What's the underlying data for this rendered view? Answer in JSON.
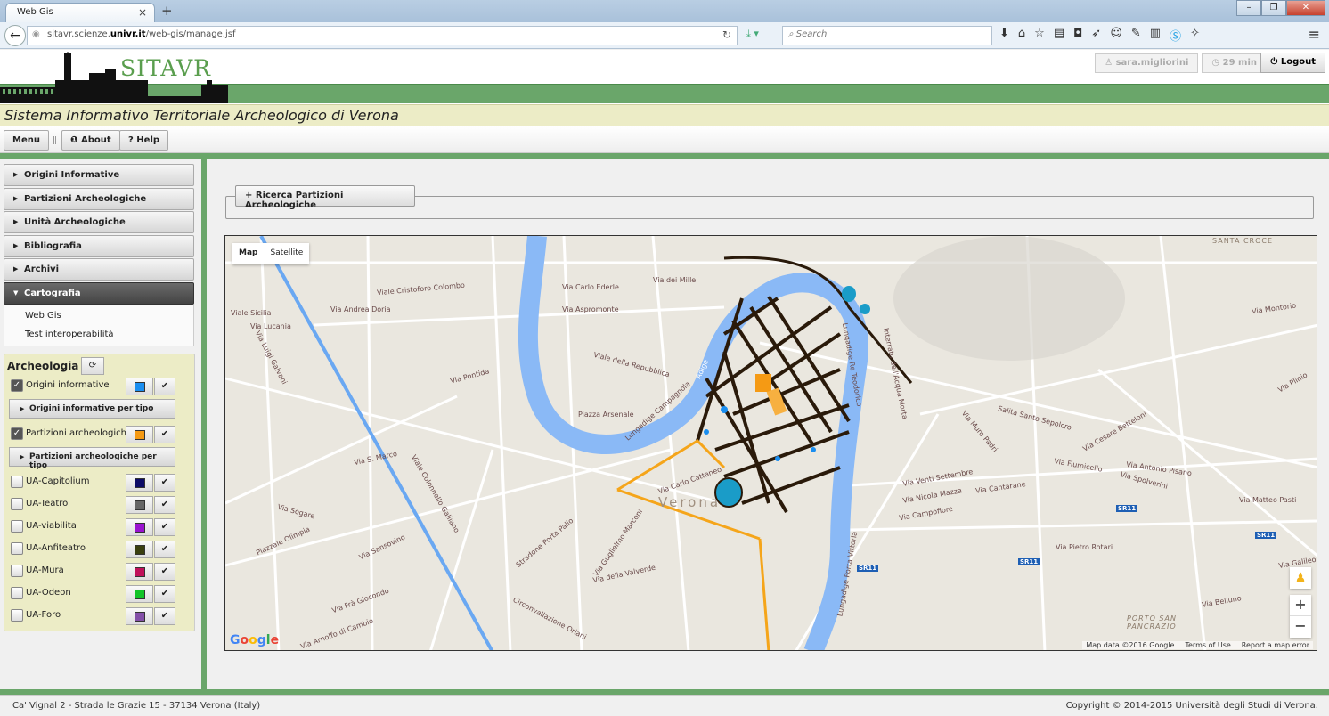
{
  "browser": {
    "tab_title": "Web Gis",
    "url_prefix": "sitavr.scienze.",
    "url_domain": "univr.it",
    "url_path": "/web-gis/manage.jsf",
    "search_placeholder": "Search"
  },
  "header": {
    "logo_text": "SITAVR",
    "user": "sara.migliorini",
    "session_time": "29 min",
    "logout_label": "Logout",
    "title": "Sistema Informativo Territoriale Archeologico di Verona"
  },
  "menubar": {
    "menu_label": "Menu",
    "about_label": "About",
    "help_label": "Help"
  },
  "sidebar": {
    "sections": [
      {
        "label": "Origini Informative"
      },
      {
        "label": "Partizioni Archeologiche"
      },
      {
        "label": "Unità Archeologiche"
      },
      {
        "label": "Bibliografia"
      },
      {
        "label": "Archivi"
      },
      {
        "label": "Cartografia"
      }
    ],
    "cartografia_items": [
      {
        "label": "Web Gis"
      },
      {
        "label": "Test interoperabilità"
      }
    ]
  },
  "layers": {
    "title": "Archeologia",
    "items": [
      {
        "label": "Origini informative",
        "checked": true,
        "color": "#1a8ef0"
      },
      {
        "label": "Partizioni archeologiche",
        "checked": true,
        "color": "#f59a14"
      },
      {
        "label": "UA-Capitolium",
        "checked": false,
        "color": "#0c0a66"
      },
      {
        "label": "UA-Teatro",
        "checked": false,
        "color": "#666666"
      },
      {
        "label": "UA-viabilita",
        "checked": false,
        "color": "#9a12d0"
      },
      {
        "label": "UA-Anfiteatro",
        "checked": false,
        "color": "#3a3f10"
      },
      {
        "label": "UA-Mura",
        "checked": false,
        "color": "#c0105a"
      },
      {
        "label": "UA-Odeon",
        "checked": false,
        "color": "#12c428"
      },
      {
        "label": "UA-Foro",
        "checked": false,
        "color": "#8450a8"
      }
    ],
    "sub_origini": "Origini informative per tipo",
    "sub_partizioni": "Partizioni archeologiche per tipo"
  },
  "main": {
    "search_panel_label": "Ricerca Partizioni Archeologiche"
  },
  "map": {
    "type_map": "Map",
    "type_satellite": "Satellite",
    "city_label": "Verona",
    "attribution": "Map data ©2016 Google",
    "terms": "Terms of Use",
    "report": "Report a map error",
    "labels": {
      "l1": "Viale Cristoforo Colombo",
      "l2": "Via Andrea Doria",
      "l3": "Viale Sicilia",
      "l4": "Via Lucania",
      "l5": "Via Luigi Galvani",
      "l6": "Via Pontida",
      "l7": "Via Carlo Ederle",
      "l8": "Via Aspromonte",
      "l9": "Via dei Mille",
      "l10": "Viale della Repubblica",
      "l11": "Piazza Arsenale",
      "l12": "Lungadige Campagnola",
      "l13": "Via Carlo Cattaneo",
      "l14": "Via S. Marco",
      "l15": "Viale Colonnello Galliano",
      "l16": "Via Sogare",
      "l17": "Piazzale Olimpia",
      "l18": "Via Sansovino",
      "l19": "Via Frà Giocondo",
      "l20": "Via Arnolfo di Cambio",
      "l21": "Stradone Porta Palio",
      "l22": "Via Guglielmo Marconi",
      "l23": "Via della Valverde",
      "l24": "Circonvallazione Oriani",
      "l25": "Lungadige Re Teodorico",
      "l26": "Interrato dell'Acqua Morta",
      "l27": "Via Venti Settembre",
      "l28": "Via Nicola Mazza",
      "l29": "Via Campofiore",
      "l30": "Via Cantarane",
      "l31": "Salita Santo Sepolcro",
      "l32": "Via Fiumicello",
      "l33": "Via Antonio Pisano",
      "l34": "Via Spolverini",
      "l35": "Via Matteo Pasti",
      "l36": "Via Pietro Rotari",
      "l37": "Via Galileo Galilei",
      "l38": "Via Belluno",
      "l39": "Via Montorio",
      "l40": "SANTA CROCE",
      "l41": "PORTO SAN PANCRAZIO",
      "l42": "Adige",
      "l43": "Lungadige Porta Vittoria",
      "l44": "Via Pietro Rotari",
      "l45": "SR11",
      "l46": "Via Muro Padri",
      "l47": "Via Cesare Betteloni",
      "l48": "Via Plinio"
    }
  },
  "footer": {
    "address": "Ca' Vignal 2 - Strada le Grazie 15 - 37134 Verona (Italy)",
    "copyright": "Copyright © 2014-2015 Università degli Studi di Verona."
  }
}
